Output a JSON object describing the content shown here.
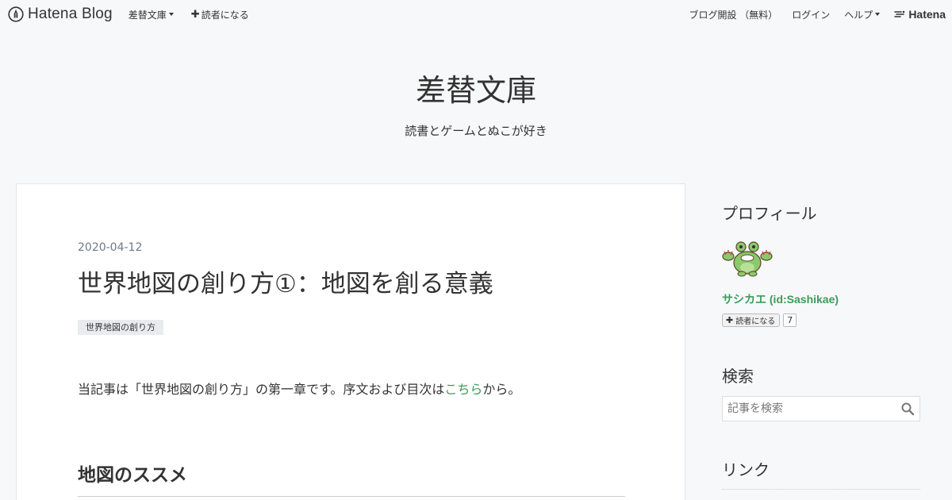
{
  "topbar": {
    "logo_text": "Hatena Blog",
    "blog_menu_label": "差替文庫",
    "subscribe_label": "読者になる",
    "open_blog_label": "ブログ開設 （無料）",
    "login_label": "ログイン",
    "help_label": "ヘルプ",
    "brand_label": "Hatena"
  },
  "header": {
    "title": "差替文庫",
    "description": "読書とゲームとぬこが好き"
  },
  "article": {
    "date": "2020-04-12",
    "title": "世界地図の創り方①：地図を創る意義",
    "category": "世界地図の創り方",
    "text_before_link": "当記事は「世界地図の創り方」の第一章です。序文および目次は",
    "link_text": "こちら",
    "text_after_link": "から。",
    "section_heading": "地図のススメ"
  },
  "sidebar": {
    "profile_title": "プロフィール",
    "profile_name": "サシカエ (id:Sashikae)",
    "subscribe_label": "読者になる",
    "subscriber_count": "7",
    "search_title": "検索",
    "search_placeholder": "記事を検索",
    "links_title": "リンク"
  },
  "colors": {
    "accent_green": "#3b9c5a",
    "background": "#f7f8fa",
    "date_gray": "#6c7a89"
  },
  "icons": {
    "logo": "hatena-pen-icon",
    "search": "magnifier-icon",
    "brand": "hatena-bird-icon"
  }
}
